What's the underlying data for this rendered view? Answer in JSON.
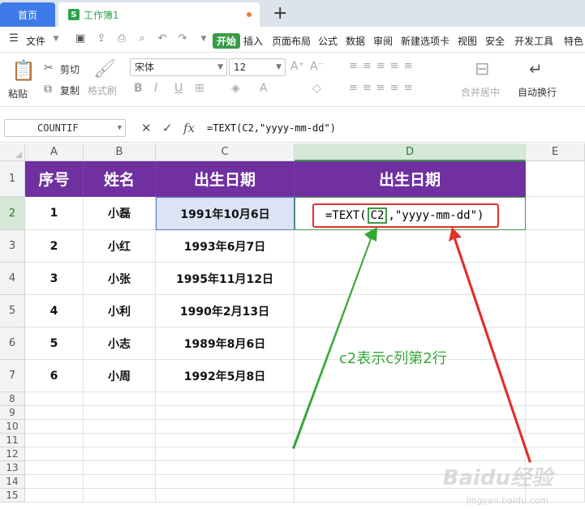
{
  "tabs": {
    "home": "首页",
    "workbook": "工作簿1",
    "workbook_icon": "S",
    "add": "+"
  },
  "menu": {
    "file": "文件",
    "items": [
      "开始",
      "插入",
      "页面布局",
      "公式",
      "数据",
      "审阅",
      "新建选项卡",
      "视图",
      "安全",
      "开发工具",
      "特色"
    ],
    "active_index": 0
  },
  "ribbon": {
    "paste": "粘贴",
    "cut": "剪切",
    "copy": "复制",
    "format_painter": "格式刷",
    "font_name": "宋体",
    "font_size": "12",
    "merge_center": "合并居中",
    "wrap_text": "自动换行",
    "bold": "B",
    "italic": "I",
    "underline": "U",
    "grow": "A⁺",
    "shrink": "A⁻"
  },
  "formula_bar": {
    "name_box": "COUNTIF",
    "cancel": "✕",
    "confirm": "✓",
    "fx": "fx",
    "formula": "=TEXT(C2,\"yyyy-mm-dd\")"
  },
  "grid": {
    "columns": [
      "A",
      "B",
      "C",
      "D",
      "E"
    ],
    "rows": [
      "1",
      "2",
      "3",
      "4",
      "5",
      "6",
      "7",
      "8",
      "9",
      "10",
      "11",
      "12",
      "13",
      "14",
      "15"
    ],
    "header": [
      "序号",
      "姓名",
      "出生日期",
      "出生日期"
    ],
    "data": [
      {
        "no": "1",
        "name": "小磊",
        "date": "1991年10月6日"
      },
      {
        "no": "2",
        "name": "小红",
        "date": "1993年6月7日"
      },
      {
        "no": "3",
        "name": "小张",
        "date": "1995年11月12日"
      },
      {
        "no": "4",
        "name": "小利",
        "date": "1990年2月13日"
      },
      {
        "no": "5",
        "name": "小志",
        "date": "1989年8月6日"
      },
      {
        "no": "6",
        "name": "小周",
        "date": "1992年5月8日"
      }
    ]
  },
  "formula_cell": {
    "prefix": "=TEXT(",
    "ref": "C2",
    "suffix": ",\"yyyy-mm-dd\")"
  },
  "annotation": "c2表示c列第2行",
  "watermark": {
    "main": "Baidu经验",
    "sub": "jingyan.baidu.com"
  },
  "colors": {
    "header_purple": "#7030a0",
    "active_green": "#3a9b46",
    "highlight_red": "#e0302a",
    "tab_blue": "#3f7be8"
  }
}
